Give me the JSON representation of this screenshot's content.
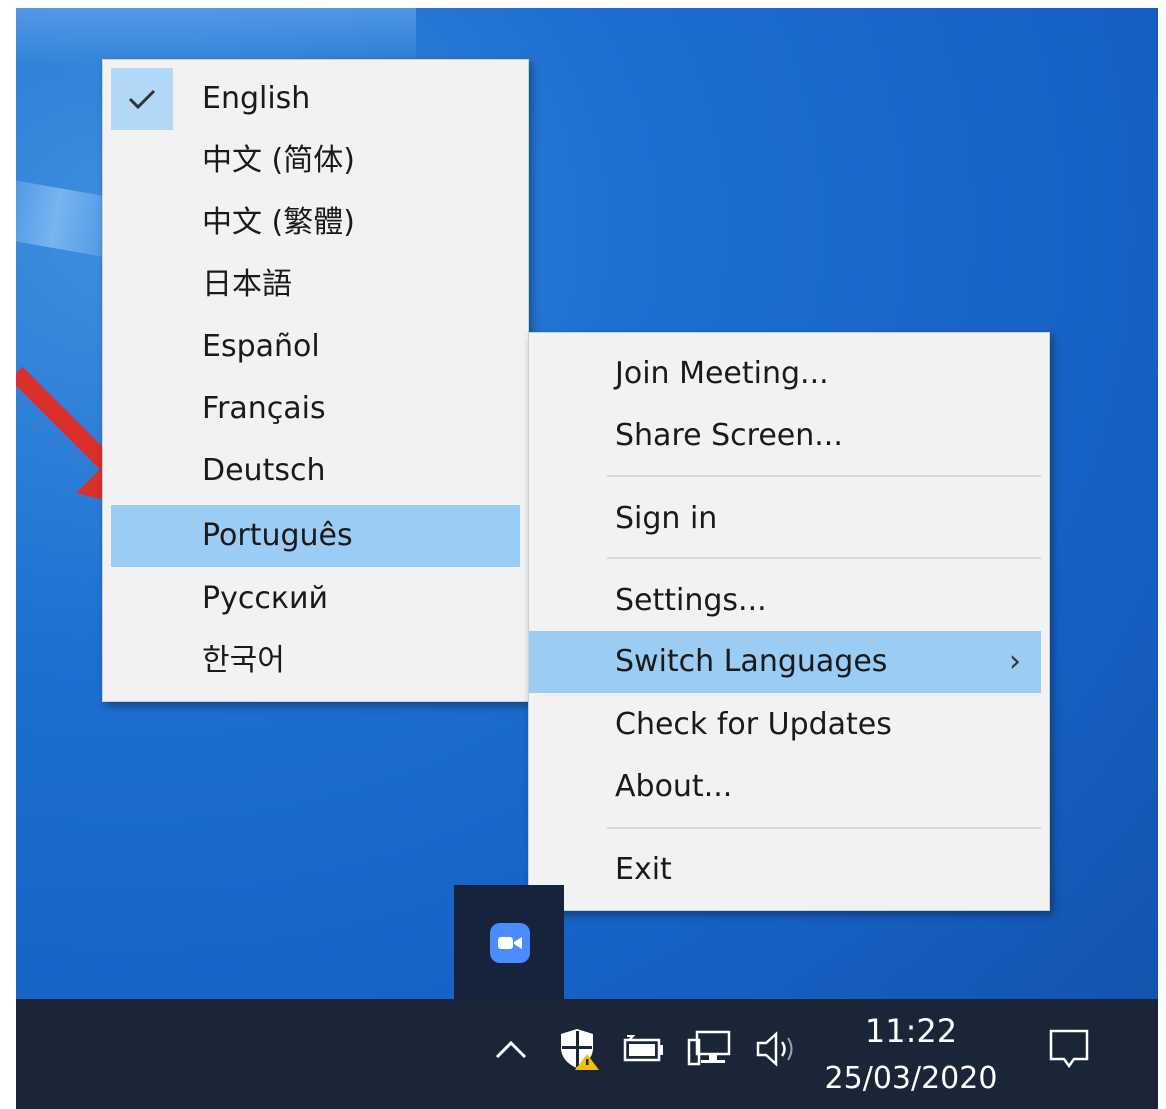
{
  "language_menu": {
    "items": [
      {
        "label": "English",
        "checked": true
      },
      {
        "label": "中文 (简体)"
      },
      {
        "label": "中文 (繁體)"
      },
      {
        "label": "日本語"
      },
      {
        "label": "Español"
      },
      {
        "label": "Français"
      },
      {
        "label": "Deutsch"
      },
      {
        "label": "Português",
        "selected": true
      },
      {
        "label": "Русский"
      },
      {
        "label": "한국어"
      }
    ]
  },
  "tray_menu": {
    "join_meeting": "Join Meeting...",
    "share_screen": "Share Screen...",
    "sign_in": "Sign in",
    "settings": "Settings...",
    "switch_languages": "Switch Languages",
    "check_updates": "Check for Updates",
    "about": "About...",
    "exit": "Exit",
    "submenu_glyph": "›"
  },
  "taskbar": {
    "time": "11:22",
    "date": "25/03/2020",
    "icons": [
      "chevron-up-icon",
      "security-shield-icon",
      "battery-icon",
      "network-icon",
      "volume-icon",
      "notification-icon"
    ]
  },
  "colors": {
    "menu_bg": "#f2f2f2",
    "highlight": "#9bccf3",
    "taskbar": "#1b2538",
    "annotation_arrow": "#d9302a",
    "zoom_blue": "#4a8cff"
  }
}
